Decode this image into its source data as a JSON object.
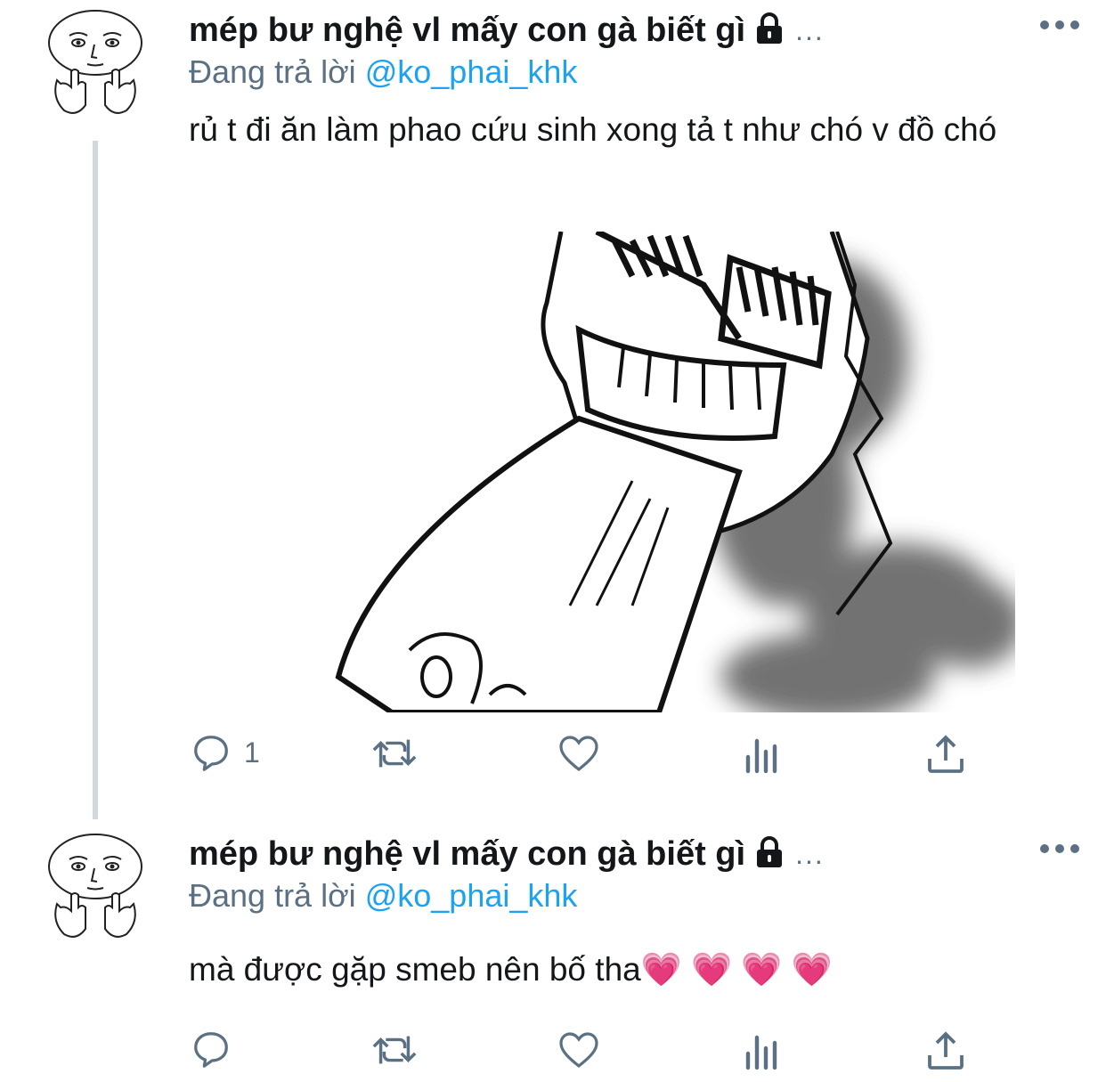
{
  "tweets": [
    {
      "author_name": "mép bư nghệ vl mấy con gà biết gì",
      "author_overflow": "...",
      "replying_prefix": "Đang trả lời",
      "replying_handle": "@ko_phai_khk",
      "text": "rủ t đi ăn làm phao cứu sinh xong tả t như chó v đồ chó",
      "has_media": true,
      "media_icon": "manga-scream-illustration",
      "actions": {
        "reply_count": "1",
        "retweet_count": "",
        "like_count": ""
      }
    },
    {
      "author_name": "mép bư nghệ vl mấy con gà biết gì",
      "author_overflow": "...",
      "replying_prefix": "Đang trả lời",
      "replying_handle": "@ko_phai_khk",
      "text": "mà được gặp smeb nên bố tha",
      "emoji": "💗 💗 💗 💗",
      "has_media": false,
      "actions": {
        "reply_count": "",
        "retweet_count": "",
        "like_count": ""
      }
    }
  ],
  "icons": {
    "lock": "lock-icon",
    "more": "more-icon",
    "reply": "reply-icon",
    "retweet": "retweet-icon",
    "like": "heart-icon",
    "analytics": "analytics-icon",
    "share": "share-icon"
  },
  "colors": {
    "text": "#14171a",
    "secondary": "#5b7083",
    "link": "#1da1f2",
    "heart": "#ff6fb1"
  }
}
